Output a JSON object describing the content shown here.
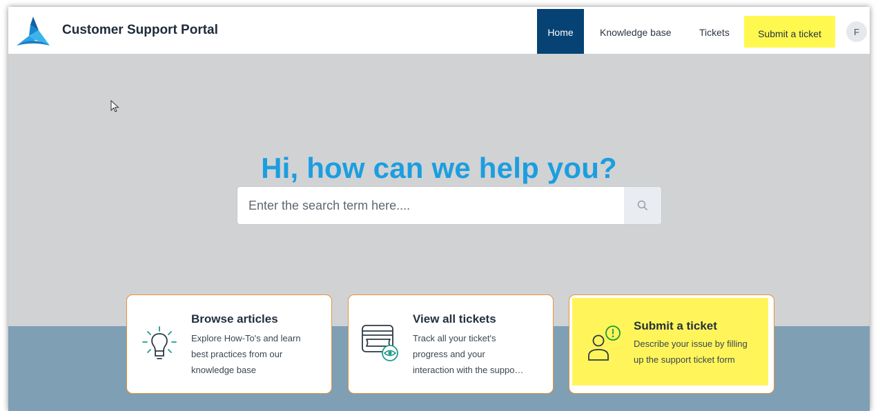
{
  "header": {
    "title": "Customer Support Portal",
    "nav": {
      "home": "Home",
      "knowledge_base": "Knowledge base",
      "tickets": "Tickets",
      "submit": "Submit a ticket"
    },
    "avatar_initial": "F"
  },
  "hero": {
    "heading": "Hi, how can we help you?"
  },
  "search": {
    "placeholder": "Enter the search term here....",
    "value": ""
  },
  "cards": [
    {
      "title": "Browse articles",
      "lines": [
        "Explore How-To's and learn",
        "best practices from our",
        "knowledge base"
      ],
      "icon": "lightbulb-icon"
    },
    {
      "title": "View all tickets",
      "lines": [
        "Track all your ticket's",
        "progress and your",
        "interaction with the suppo…"
      ],
      "icon": "ticket-view-icon"
    },
    {
      "title": "Submit a ticket",
      "lines": [
        "Describe your issue by filling",
        "up the support ticket form"
      ],
      "icon": "user-alert-icon"
    }
  ],
  "colors": {
    "brand_blue": "#1b9ee0",
    "nav_active": "#064374",
    "highlight": "#fff94f",
    "card_border": "#e8923a",
    "band": "#7f9fb4",
    "hero_bg": "#d1d2d4"
  }
}
